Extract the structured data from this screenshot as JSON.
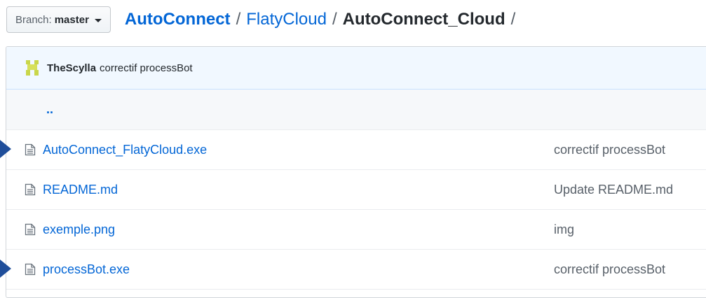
{
  "branch": {
    "prefix": "Branch:",
    "name": "master"
  },
  "breadcrumb": {
    "root": "AutoConnect",
    "middle": "FlatyCloud",
    "current": "AutoConnect_Cloud",
    "separator": "/"
  },
  "latest_commit": {
    "author": "TheScylla",
    "message": "correctif processBot"
  },
  "parent_dir": "..",
  "files": [
    {
      "name": "AutoConnect_FlatyCloud.exe",
      "commit": "correctif processBot",
      "marked": true
    },
    {
      "name": "README.md",
      "commit": "Update README.md",
      "marked": false
    },
    {
      "name": "exemple.png",
      "commit": "img",
      "marked": false
    },
    {
      "name": "processBot.exe",
      "commit": "correctif processBot",
      "marked": true
    }
  ],
  "colors": {
    "link": "#0366d6",
    "commit_bar_bg": "#f1f8ff",
    "marker": "#1f4e9a"
  }
}
